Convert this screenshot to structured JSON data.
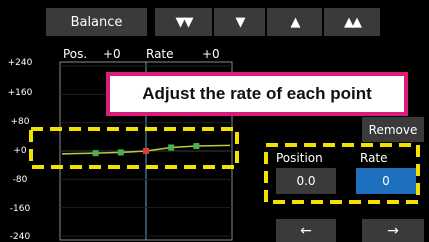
{
  "toolbar": {
    "balance_label": "Balance",
    "arrows": [
      "▼▼",
      "▼",
      "▲",
      "▲▲"
    ]
  },
  "header": {
    "pos_label": "Pos.",
    "pos_value": "+0",
    "rate_label": "Rate",
    "rate_value": "+0"
  },
  "y_ticks": [
    "+240",
    "+160",
    "+80",
    "+0",
    "-80",
    "-160",
    "-240"
  ],
  "callout": "Adjust the rate of each point",
  "panel": {
    "remove_label": "Remove",
    "position_label": "Position",
    "rate_label": "Rate",
    "position_value": "0.0",
    "rate_value": "0",
    "left_arrow": "←",
    "right_arrow": "→"
  },
  "colors": {
    "button_bg": "#3a3a3a",
    "highlight": "#f2e200",
    "callout_border": "#d91e7a",
    "rate_field": "#1f6fbf",
    "curve": "#b6cc44",
    "point": "#4caf50",
    "active_point": "#e53935"
  },
  "chart_data": {
    "type": "line",
    "xlim": [
      -100,
      100
    ],
    "ylim": [
      -240,
      240
    ],
    "y_ticks": [
      240,
      160,
      80,
      0,
      -80,
      -160,
      -240
    ],
    "points": [
      {
        "x": -100,
        "y": -8,
        "selected": false
      },
      {
        "x": -60,
        "y": -6,
        "selected": false
      },
      {
        "x": -30,
        "y": -4,
        "selected": false
      },
      {
        "x": 0,
        "y": 0,
        "selected": true
      },
      {
        "x": 30,
        "y": 10,
        "selected": false
      },
      {
        "x": 60,
        "y": 14,
        "selected": false
      },
      {
        "x": 100,
        "y": 16,
        "selected": false
      }
    ]
  }
}
